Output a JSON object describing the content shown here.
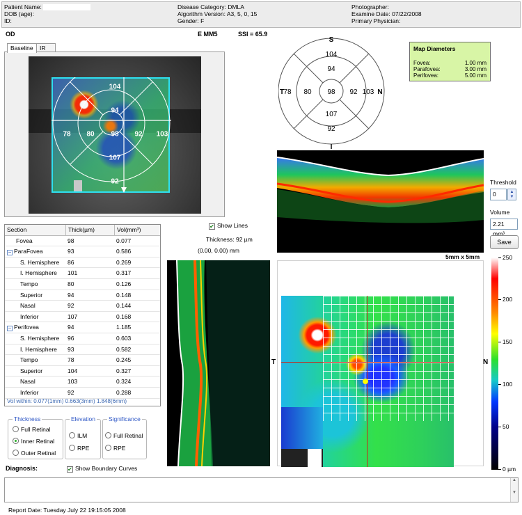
{
  "header": {
    "patient_name_label": "Patient Name:",
    "dob_label": "DOB (age):",
    "id_label": "ID:",
    "disease_category": "Disease Category: DMLA",
    "algorithm_version": "Algorithm Version: A3, 5, 0, 15",
    "gender": "Gender: F",
    "photographer": "Photographer:",
    "examine_date": "Examine Date: 07/22/2008",
    "primary_physician": "Primary Physician:"
  },
  "eye": "OD",
  "scan_type": "E MM5",
  "ssi": "SSI = 65.9",
  "tabs": [
    {
      "label": "Baseline",
      "active": true
    },
    {
      "label": "IR",
      "active": false
    }
  ],
  "fundus_values": {
    "superior_outer": "104",
    "superior_inner": "94",
    "temporal_outer": "78",
    "temporal_inner": "80",
    "center": "98",
    "nasal_inner": "92",
    "nasal_outer": "103",
    "inferior_inner": "107",
    "inferior_outer": "92"
  },
  "chart_diagram": {
    "label_s": "S",
    "label_t": "T",
    "label_n": "N",
    "label_i": "I",
    "superior_outer": "104",
    "superior_inner": "94",
    "temporal_outer": "78",
    "temporal_inner": "80",
    "center": "98",
    "nasal_inner": "92",
    "nasal_outer": "103",
    "inferior_inner": "107",
    "inferior_outer": "92"
  },
  "map_diameters": {
    "title": "Map Diameters",
    "rows": [
      {
        "label": "Fovea:",
        "value": "1.00 mm"
      },
      {
        "label": "Parafovea:",
        "value": "3.00 mm"
      },
      {
        "label": "Perifovea:",
        "value": "5.00 mm"
      }
    ]
  },
  "threshold": {
    "label": "Threshold",
    "value": "0"
  },
  "volume": {
    "label": "Volume",
    "value": "2.21 mm³"
  },
  "save_label": "Save",
  "scan_size": "5mm x 5mm",
  "show_lines": {
    "label": "Show Lines",
    "checked": true
  },
  "thickness_readout": "Thickness: 92 µm",
  "coord_readout": "(0.00, 0.00) mm",
  "table": {
    "headers": [
      "Section",
      "Thick(µm)",
      "Vol(mm³)"
    ],
    "rows": [
      {
        "section": "Fovea",
        "thick": "98",
        "vol": "0.077"
      },
      {
        "section": "ParaFovea",
        "thick": "93",
        "vol": "0.586"
      },
      {
        "section": "S. Hemisphere",
        "thick": "86",
        "vol": "0.269"
      },
      {
        "section": "I. Hemisphere",
        "thick": "101",
        "vol": "0.317"
      },
      {
        "section": "Tempo",
        "thick": "80",
        "vol": "0.126"
      },
      {
        "section": "Superior",
        "thick": "94",
        "vol": "0.148"
      },
      {
        "section": "Nasal",
        "thick": "92",
        "vol": "0.144"
      },
      {
        "section": "Inferior",
        "thick": "107",
        "vol": "0.168"
      },
      {
        "section": "Perifovea",
        "thick": "94",
        "vol": "1.185"
      },
      {
        "section": "S. Hemisphere",
        "thick": "96",
        "vol": "0.603"
      },
      {
        "section": "I. Hemisphere",
        "thick": "93",
        "vol": "0.582"
      },
      {
        "section": "Tempo",
        "thick": "78",
        "vol": "0.245"
      },
      {
        "section": "Superior",
        "thick": "104",
        "vol": "0.327"
      },
      {
        "section": "Nasal",
        "thick": "103",
        "vol": "0.324"
      },
      {
        "section": "Inferior",
        "thick": "92",
        "vol": "0.288"
      }
    ],
    "vol_within": "Vol within: 0.077(1mm) 0.663(3mm) 1.848(6mm)"
  },
  "thickness_group": {
    "title": "Thickness",
    "options": [
      "Full Retinal",
      "Inner Retinal",
      "Outer Retinal"
    ],
    "selected": "Inner Retinal"
  },
  "elevation_group": {
    "title": "Elevation",
    "options": [
      "ILM",
      "RPE"
    ]
  },
  "significance_group": {
    "title": "Significance",
    "options": [
      "Full Retinal",
      "RPE"
    ]
  },
  "show_boundary": {
    "label": "Show Boundary Curves",
    "checked": true
  },
  "diagnosis_label": "Diagnosis:",
  "report_date": "Report Date: Tuesday July 22 19:15:05 2008",
  "map_labels": {
    "t": "T",
    "n": "N"
  },
  "colorbar_ticks": [
    "250",
    "200",
    "150",
    "100",
    "50",
    "0 µm"
  ],
  "colors": {
    "accent_cyan": "#2ee0f0",
    "legend_blue": "#2f58c6",
    "map_diam_bg": "#d8f5a6"
  }
}
